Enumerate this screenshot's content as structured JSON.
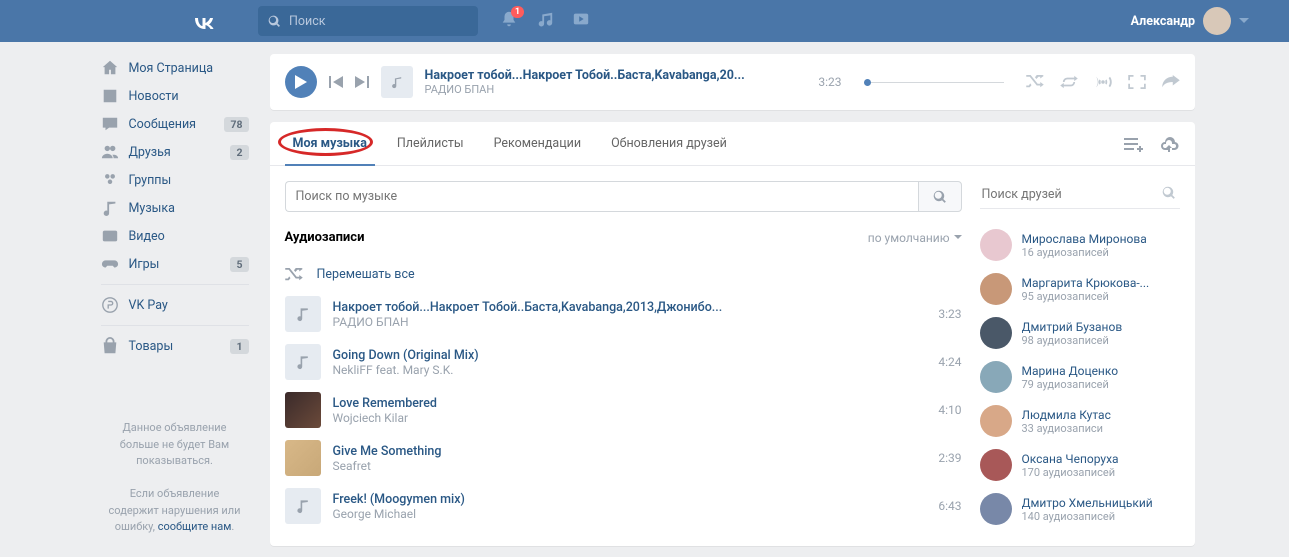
{
  "header": {
    "search_placeholder": "Поиск",
    "notif_badge": "1",
    "user_name": "Александр"
  },
  "sidebar": {
    "items": [
      {
        "label": "Моя Страница",
        "icon": "home"
      },
      {
        "label": "Новости",
        "icon": "news"
      },
      {
        "label": "Сообщения",
        "icon": "msg",
        "count": "78"
      },
      {
        "label": "Друзья",
        "icon": "friends",
        "count": "2"
      },
      {
        "label": "Группы",
        "icon": "groups"
      },
      {
        "label": "Музыка",
        "icon": "music"
      },
      {
        "label": "Видео",
        "icon": "video"
      },
      {
        "label": "Игры",
        "icon": "games",
        "count": "5"
      }
    ],
    "vkpay": "VK Pay",
    "goods": "Товары",
    "goods_count": "1",
    "ad_text1": "Данное объявление больше не будет Вам показываться.",
    "ad_text2": "Если объявление содержит нарушения или ошибку, ",
    "ad_link": "сообщите нам"
  },
  "player": {
    "title": "Накроет тобой...Накроет Тобой..Баста,Kavabanga,20...",
    "artist": "РАДИО БПАН",
    "duration": "3:23"
  },
  "tabs": [
    "Моя музыка",
    "Плейлисты",
    "Рекомендации",
    "Обновления друзей"
  ],
  "music_search_placeholder": "Поиск по музыке",
  "section_title": "Аудиозаписи",
  "sort_label": "по умолчанию",
  "shuffle_label": "Перемешать все",
  "tracks": [
    {
      "title": "Накроет тобой...Накроет Тобой..Баста,Kavabanga,2013,Джонибо...",
      "artist": "РАДИО БПАН",
      "dur": "3:23",
      "thumb": "note"
    },
    {
      "title": "Going Down (Original Mix)",
      "artist": "NekliFF feat. Mary S.K.",
      "dur": "4:24",
      "thumb": "note"
    },
    {
      "title": "Love Remembered",
      "artist": "Wojciech Kilar",
      "dur": "4:10",
      "thumb": "img1"
    },
    {
      "title": "Give Me Something",
      "artist": "Seafret",
      "dur": "2:39",
      "thumb": "img2"
    },
    {
      "title": "Freek! (Moogymen mix)",
      "artist": "George Michael",
      "dur": "6:43",
      "thumb": "note"
    }
  ],
  "friend_search_placeholder": "Поиск друзей",
  "friends": [
    {
      "name": "Мирослава Миронова",
      "sub": "16 аудиозаписей",
      "color": "#e8c8d0"
    },
    {
      "name": "Маргарита Крюкова-...",
      "sub": "95 аудиозаписей",
      "color": "#c89878"
    },
    {
      "name": "Дмитрий Бузанов",
      "sub": "98 аудиозаписей",
      "color": "#4a5868"
    },
    {
      "name": "Марина Доценко",
      "sub": "79 аудиозаписей",
      "color": "#88a8b8"
    },
    {
      "name": "Людмила Кутас",
      "sub": "33 аудиозаписи",
      "color": "#d8a888"
    },
    {
      "name": "Оксана Чепоруха",
      "sub": "170 аудиозаписей",
      "color": "#a85858"
    },
    {
      "name": "Дмитро Хмельницький",
      "sub": "140 аудиозаписей",
      "color": "#7888a8"
    }
  ]
}
